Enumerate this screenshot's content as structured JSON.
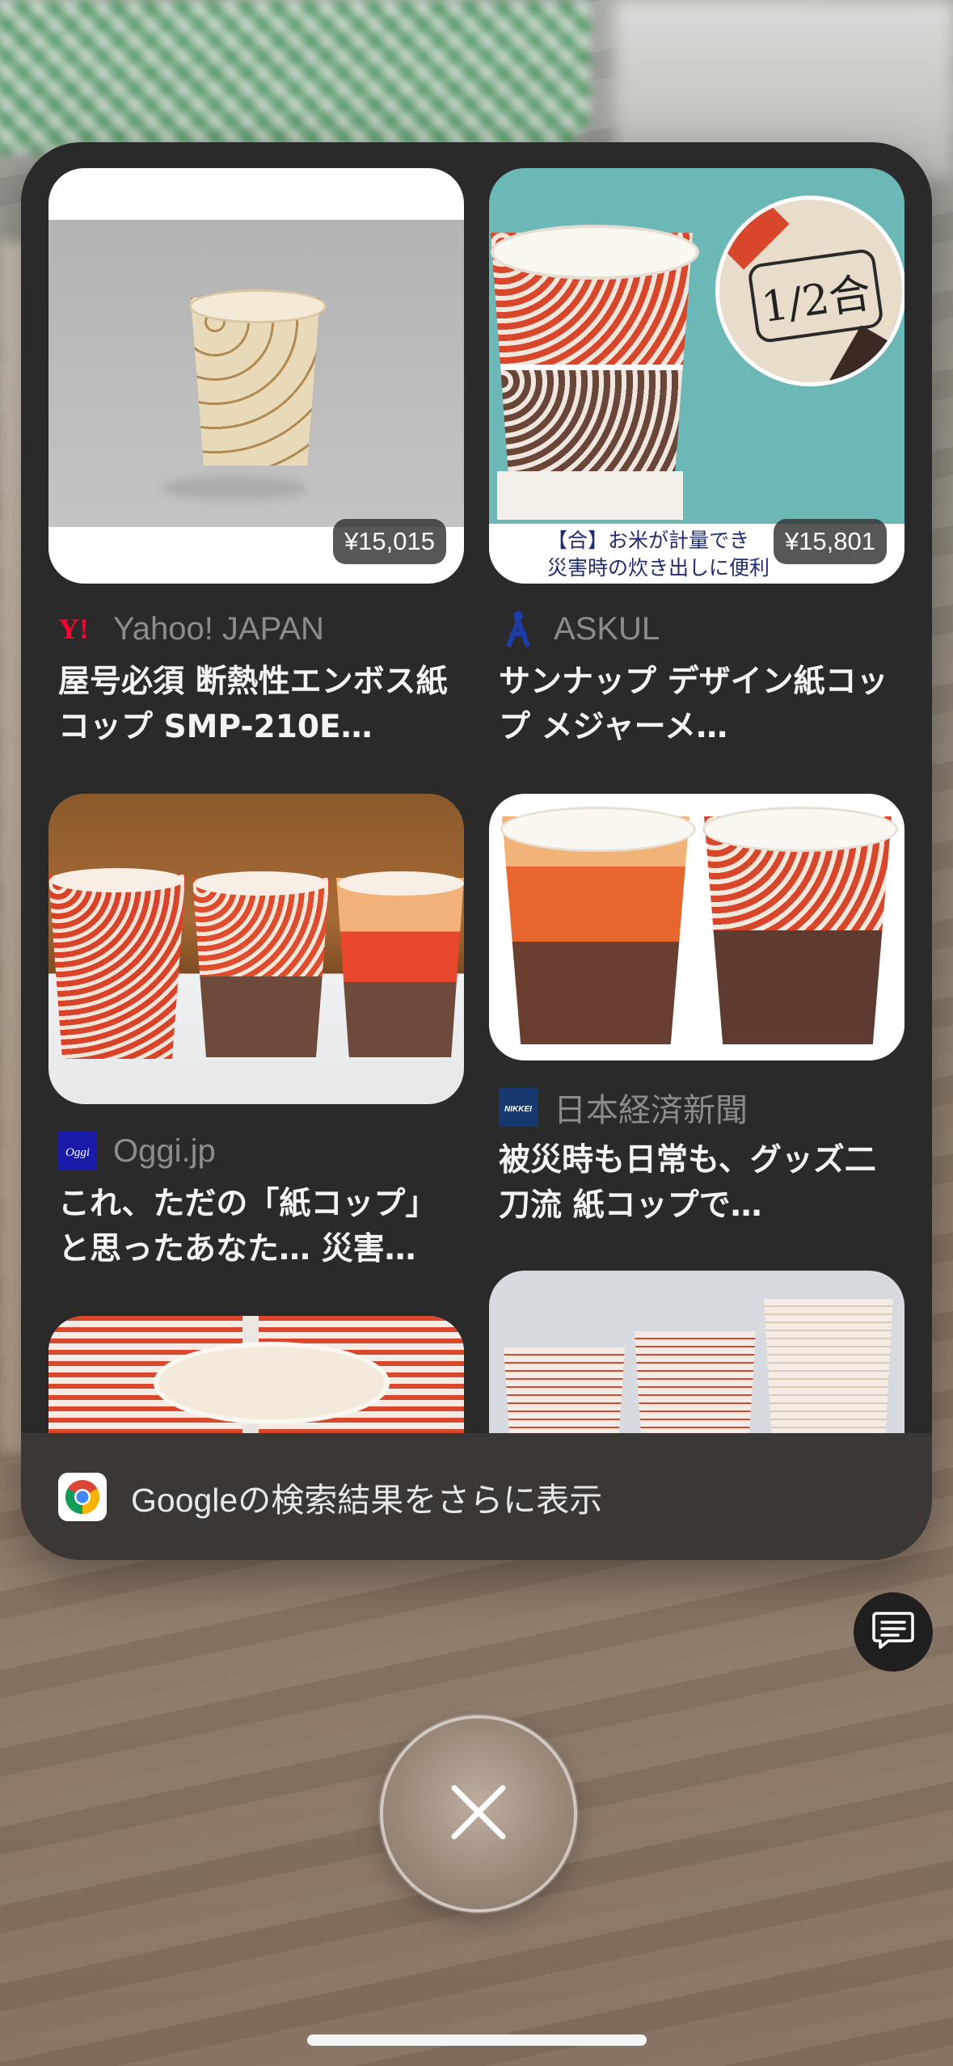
{
  "results": [
    {
      "source": "Yahoo! JAPAN",
      "title": "屋号必須 断熱性エンボス紙コップ SMP-210E…",
      "price": "¥15,015"
    },
    {
      "source": "ASKUL",
      "title": "サンナップ デザイン紙コップ メジャーメ…",
      "price": "¥15,801",
      "image_caption": "【合】お米が計量でき\n災害時の炊き出しに便利",
      "image_badge": "1/2合"
    },
    {
      "source": "Oggi.jp",
      "title": "これ、ただの「紙コップ」と思ったあなた… 災害…"
    },
    {
      "source": "日本経済新聞",
      "title": "被災時も日常も、グッズ二刀流 紙コップで…"
    }
  ],
  "more_results": {
    "label": "Googleの検索結果をさらに表示"
  },
  "colors": {
    "sheet": "#2a2a2a",
    "yahoo_red": "#ff0033",
    "askul_blue": "#1e3ca8",
    "oggi_blue": "#1a1aa8",
    "nikkei_navy": "#15386e"
  }
}
